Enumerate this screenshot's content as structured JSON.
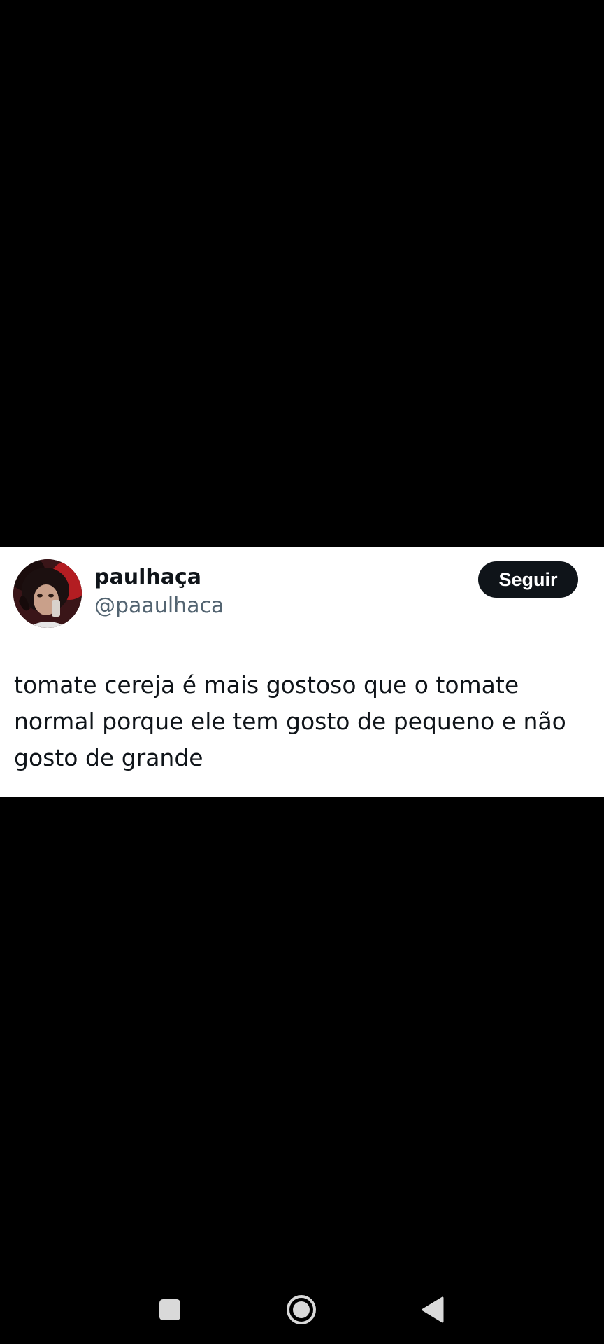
{
  "tweet": {
    "display_name": "paulhaça",
    "handle": "@paaulhaca",
    "follow_label": "Seguir",
    "text": "tomate cereja é mais gostoso que o tomate normal porque ele tem gosto de pequeno e não gosto de grande"
  },
  "navigation": {
    "recents_icon": "square-icon",
    "home_icon": "circle-home-icon",
    "back_icon": "triangle-back-icon"
  },
  "colors": {
    "background": "#000000",
    "card": "#ffffff",
    "text_primary": "#0f1419",
    "text_secondary": "#536471",
    "button": "#0f1419",
    "nav_icons": "#d9d9d9"
  }
}
